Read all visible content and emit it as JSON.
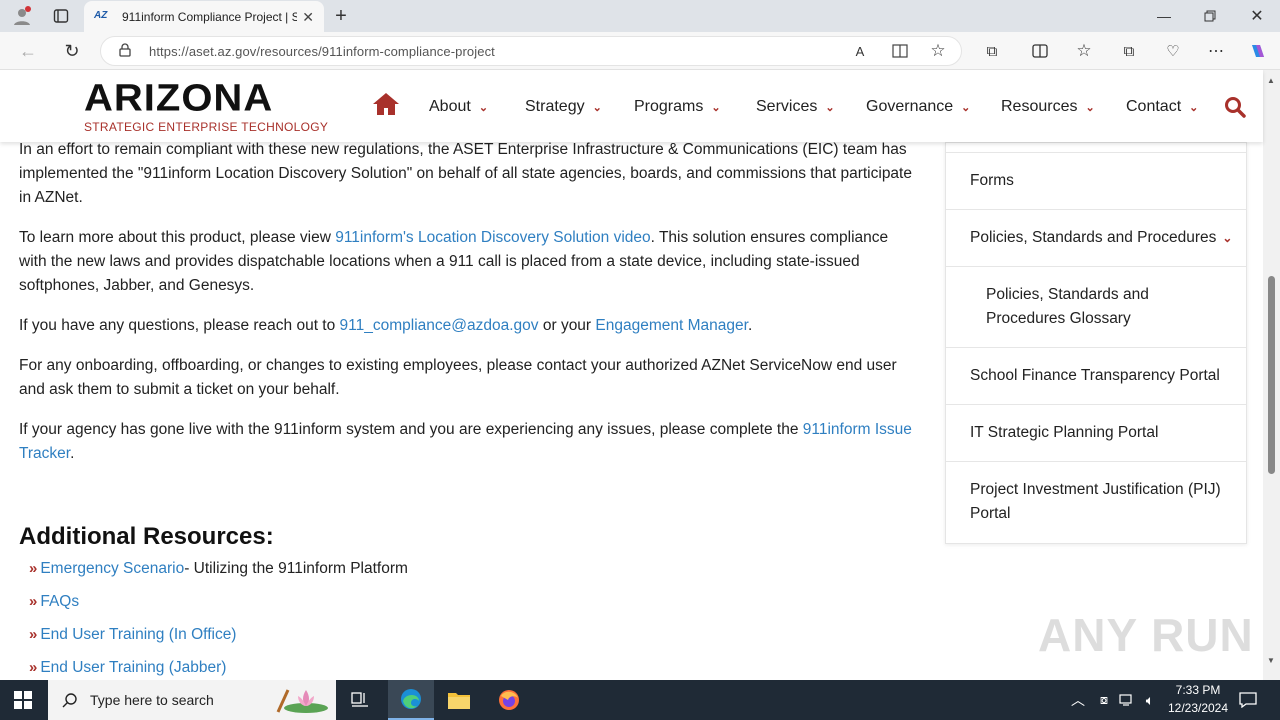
{
  "browser": {
    "tab_title": "911inform Compliance Project | S",
    "favicon_text": "AZ",
    "url": "https://aset.az.gov/resources/911inform-compliance-project"
  },
  "site": {
    "logo": "ARIZONA",
    "logo_sub": "STRATEGIC ENTERPRISE TECHNOLOGY",
    "brand_color": "#a8312b",
    "link_color": "#2f7fc1",
    "nav": [
      "About",
      "Strategy",
      "Programs",
      "Services",
      "Governance",
      "Resources",
      "Contact"
    ]
  },
  "content": {
    "p1": "In an effort to remain compliant with these new regulations, the ASET Enterprise Infrastructure & Communications (EIC) team has implemented the \"911inform Location Discovery Solution\" on behalf of all state agencies, boards, and commissions that participate in AZNet.",
    "p2_pre": "To learn more about this product, please view ",
    "p2_link": "911inform's Location Discovery Solution video",
    "p2_post": ". This solution ensures compliance with the new laws and provides dispatchable locations when a 911 call is placed from a state device, including state-issued softphones, Jabber, and Genesys.",
    "p3_pre": "If you have any questions, please reach out to ",
    "p3_link1": "911_compliance@azdoa.gov",
    "p3_mid": " or your ",
    "p3_link2": "Engagement Manager",
    "p3_post": ".",
    "p4": "For any onboarding, offboarding, or changes to existing employees, please contact your authorized AZNet ServiceNow end user and ask them to submit a ticket on your behalf.",
    "p5_pre": "If your agency has gone live with the 911inform system and you are experiencing any issues, please complete the ",
    "p5_link": "911inform Issue Tracker",
    "p5_post": ".",
    "resources_heading": "Additional Resources:",
    "resources": [
      {
        "link": "Emergency Scenario",
        "suffix": " - Utilizing the 911inform Platform"
      },
      {
        "link": "FAQs",
        "suffix": ""
      },
      {
        "link": "End User Training (In Office)",
        "suffix": ""
      },
      {
        "link": "End User Training (Jabber)",
        "suffix": ""
      }
    ]
  },
  "sidebar": {
    "items": [
      "Forms",
      "Policies, Standards and Procedures",
      "Policies, Standards and Procedures Glossary",
      "School Finance Transparency Portal",
      "IT Strategic Planning Portal",
      "Project Investment Justification (PIJ) Portal"
    ]
  },
  "watermark": "ANY RUN",
  "taskbar": {
    "search_placeholder": "Type here to search",
    "time": "7:33 PM",
    "date": "12/23/2024"
  }
}
